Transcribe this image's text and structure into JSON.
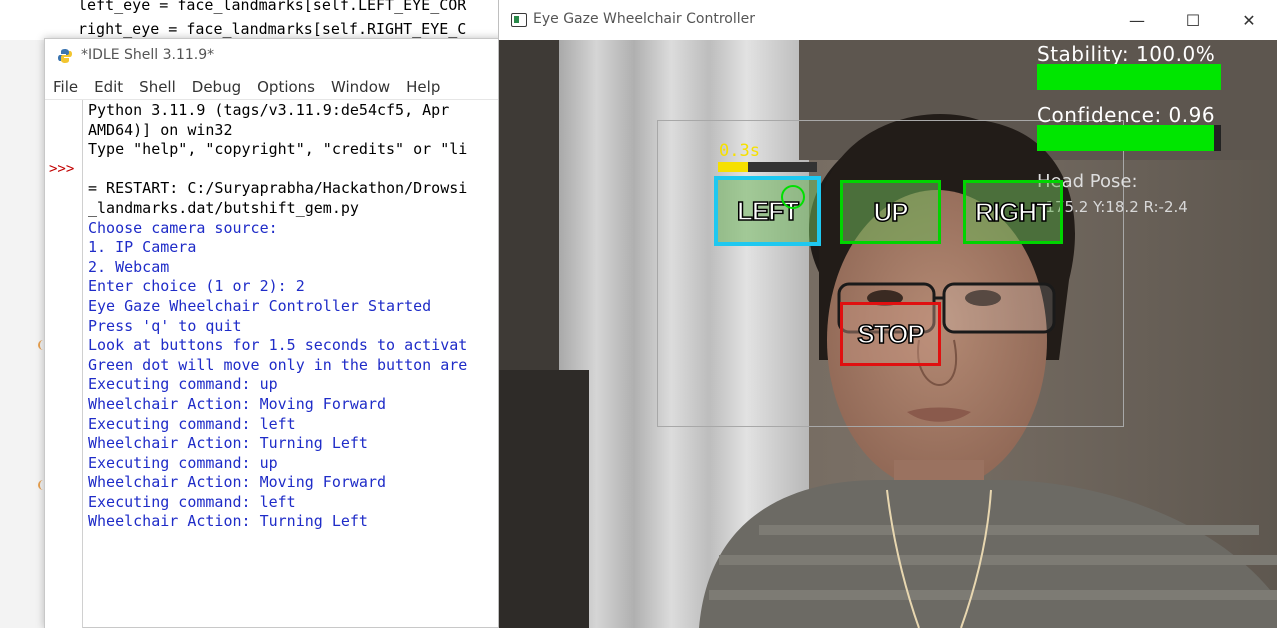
{
  "background_editor": {
    "line1": "left_eye = face_landmarks[self.LEFT_EYE_COR",
    "line2": "right_eye = face_landmarks[self.RIGHT_EYE_C"
  },
  "idle": {
    "title": "*IDLE Shell 3.11.9*",
    "menu": [
      "File",
      "Edit",
      "Shell",
      "Debug",
      "Options",
      "Window",
      "Help"
    ],
    "prompt": ">>>",
    "lines": [
      {
        "text": "Python 3.11.9 (tags/v3.11.9:de54cf5, Apr",
        "style": "out"
      },
      {
        "text": "AMD64)] on win32",
        "style": "out"
      },
      {
        "text": "Type \"help\", \"copyright\", \"credits\" or \"li",
        "style": "out"
      },
      {
        "text": "",
        "style": "out"
      },
      {
        "text": "= RESTART: C:/Suryaprabha/Hackathon/Drowsi",
        "style": "out"
      },
      {
        "text": "_landmarks.dat/butshift_gem.py",
        "style": "out"
      },
      {
        "text": "Choose camera source:",
        "style": "blue"
      },
      {
        "text": "1. IP Camera",
        "style": "blue"
      },
      {
        "text": "2. Webcam",
        "style": "blue"
      },
      {
        "text": "Enter choice (1 or 2): 2",
        "style": "blue"
      },
      {
        "text": "Eye Gaze Wheelchair Controller Started",
        "style": "blue"
      },
      {
        "text": "Press 'q' to quit",
        "style": "blue"
      },
      {
        "text": "Look at buttons for 1.5 seconds to activat",
        "style": "blue"
      },
      {
        "text": "Green dot will move only in the button are",
        "style": "blue"
      },
      {
        "text": "Executing command: up",
        "style": "blue"
      },
      {
        "text": "Wheelchair Action: Moving Forward",
        "style": "blue"
      },
      {
        "text": "Executing command: left",
        "style": "blue"
      },
      {
        "text": "Wheelchair Action: Turning Left",
        "style": "blue"
      },
      {
        "text": "Executing command: up",
        "style": "blue"
      },
      {
        "text": "Wheelchair Action: Moving Forward",
        "style": "blue"
      },
      {
        "text": "Executing command: left",
        "style": "blue"
      },
      {
        "text": "Wheelchair Action: Turning Left",
        "style": "blue"
      }
    ]
  },
  "camera": {
    "title": "Eye Gaze Wheelchair Controller",
    "window_buttons": {
      "minimize": "—",
      "maximize": "☐",
      "close": "✕"
    },
    "stability_label": "Stability: 100.0%",
    "stability_fraction": 1.0,
    "confidence_label": "Confidence: 0.96",
    "confidence_fraction": 0.96,
    "head_pose_label": "Head Pose:",
    "head_pose_values": "-175.2 Y:18.2 R:-2.4",
    "dwell_timer_label": "0.3s",
    "dwell_fraction": 0.3,
    "buttons": {
      "left": "LEFT",
      "up": "UP",
      "right": "RIGHT",
      "stop": "STOP"
    },
    "colors": {
      "active_button_border": "#1ec8f0",
      "button_border": "#00d400",
      "stop_border": "#e01010",
      "bar_fill": "#00e600",
      "timer_fill": "#f6e000"
    }
  }
}
